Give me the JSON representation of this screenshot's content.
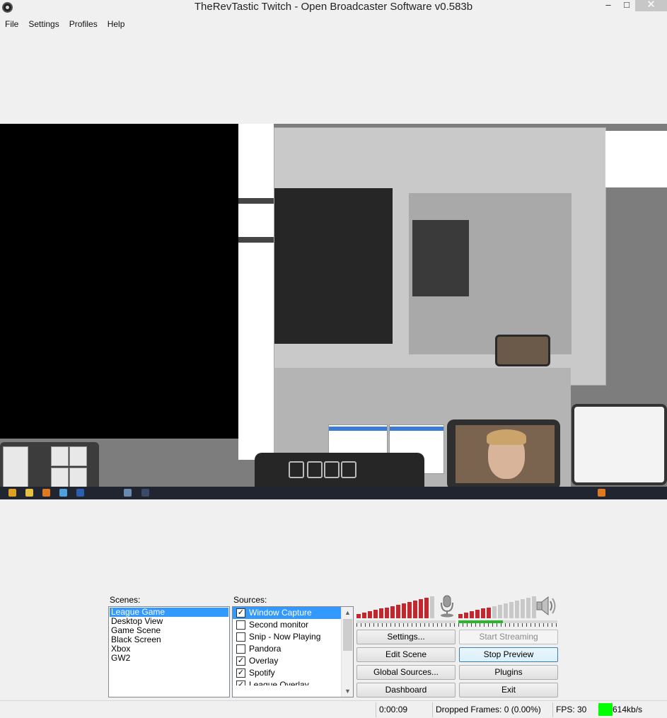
{
  "window": {
    "title": "TheRevTastic Twitch - Open Broadcaster Software v0.583b",
    "min": "–",
    "max": "□",
    "close": "✕"
  },
  "menu": [
    "File",
    "Settings",
    "Profiles",
    "Help"
  ],
  "scenes": {
    "label": "Scenes:",
    "items": [
      "League Game",
      "Desktop View",
      "Game Scene",
      "Black Screen",
      "Xbox",
      "GW2"
    ],
    "selected_index": 0
  },
  "sources": {
    "label": "Sources:",
    "items": [
      {
        "name": "Window Capture",
        "checked": true,
        "selected": true
      },
      {
        "name": "Second monitor",
        "checked": false
      },
      {
        "name": "Snip - Now Playing",
        "checked": false
      },
      {
        "name": "Pandora",
        "checked": false
      },
      {
        "name": "Overlay",
        "checked": true
      },
      {
        "name": "Spotify",
        "checked": true
      },
      {
        "name": "League Overlay",
        "checked": true
      }
    ]
  },
  "audio": {
    "mic_icon": "microphone-icon",
    "speaker_icon": "speaker-icon",
    "mic_level": 0.95,
    "desktop_level": 0.45,
    "colors": {
      "active": "#c1272d",
      "inactive": "#c8c8c8",
      "volume": "#2bb52b"
    }
  },
  "buttons": {
    "settings": "Settings...",
    "start_streaming": "Start Streaming",
    "edit_scene": "Edit Scene",
    "stop_preview": "Stop Preview",
    "global_sources": "Global Sources...",
    "plugins": "Plugins",
    "dashboard": "Dashboard",
    "exit": "Exit"
  },
  "status": {
    "time": "0:00:09",
    "dropped_frames": "Dropped Frames: 0 (0.00%)",
    "fps": "FPS: 30",
    "bitrate": "614kb/s",
    "bitrate_color": "#00ff00"
  }
}
